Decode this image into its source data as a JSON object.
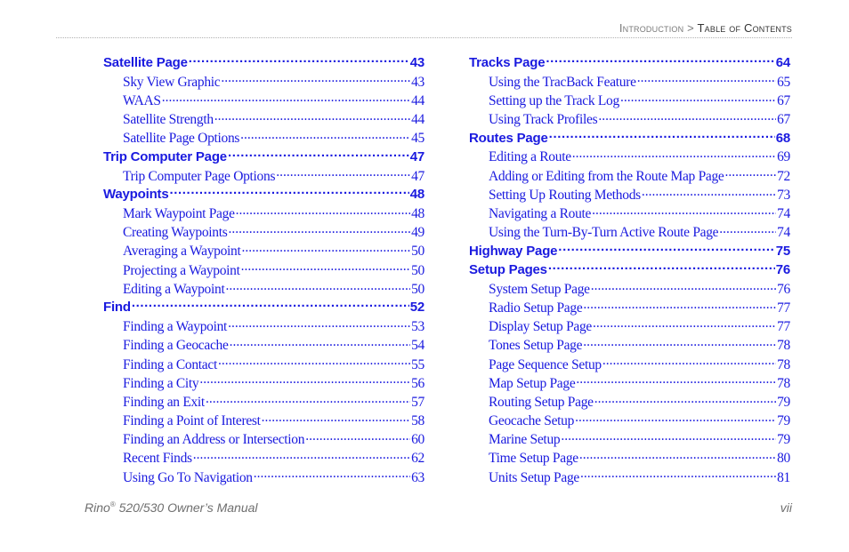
{
  "header": {
    "breadcrumb_parent": "Introduction",
    "breadcrumb_separator": " > ",
    "breadcrumb_current": "Table of Contents"
  },
  "colors": {
    "link": "#1a1adf",
    "header_text": "#7a7a7a",
    "footer_text": "#6f6f6f"
  },
  "toc": {
    "left": [
      {
        "level": 1,
        "title": "Satellite Page",
        "page": "43"
      },
      {
        "level": 2,
        "title": "Sky View Graphic",
        "page": "43"
      },
      {
        "level": 2,
        "title": "WAAS",
        "page": "44"
      },
      {
        "level": 2,
        "title": "Satellite Strength",
        "page": "44"
      },
      {
        "level": 2,
        "title": "Satellite Page Options",
        "page": "45"
      },
      {
        "level": 1,
        "title": "Trip Computer Page",
        "page": "47"
      },
      {
        "level": 2,
        "title": "Trip Computer Page Options",
        "page": "47"
      },
      {
        "level": 1,
        "title": "Waypoints",
        "page": "48"
      },
      {
        "level": 2,
        "title": "Mark Waypoint Page",
        "page": "48"
      },
      {
        "level": 2,
        "title": "Creating Waypoints",
        "page": "49"
      },
      {
        "level": 2,
        "title": "Averaging a Waypoint",
        "page": "50"
      },
      {
        "level": 2,
        "title": "Projecting a Waypoint",
        "page": "50"
      },
      {
        "level": 2,
        "title": "Editing a Waypoint",
        "page": "50"
      },
      {
        "level": 1,
        "title": "Find",
        "page": "52"
      },
      {
        "level": 2,
        "title": "Finding a Waypoint",
        "page": "53"
      },
      {
        "level": 2,
        "title": "Finding a Geocache",
        "page": "54"
      },
      {
        "level": 2,
        "title": "Finding a Contact",
        "page": "55"
      },
      {
        "level": 2,
        "title": "Finding a City",
        "page": "56"
      },
      {
        "level": 2,
        "title": "Finding an Exit",
        "page": "57"
      },
      {
        "level": 2,
        "title": "Finding a Point of Interest",
        "page": "58"
      },
      {
        "level": 2,
        "title": "Finding an Address or Intersection",
        "page": "60"
      },
      {
        "level": 2,
        "title": "Recent Finds",
        "page": "62"
      },
      {
        "level": 2,
        "title": "Using Go To Navigation",
        "page": "63"
      }
    ],
    "right": [
      {
        "level": 1,
        "title": "Tracks Page",
        "page": "64"
      },
      {
        "level": 2,
        "title": "Using the TracBack Feature",
        "page": "65"
      },
      {
        "level": 2,
        "title": "Setting up the Track Log",
        "page": "67"
      },
      {
        "level": 2,
        "title": "Using Track Profiles",
        "page": "67"
      },
      {
        "level": 1,
        "title": "Routes Page",
        "page": "68"
      },
      {
        "level": 2,
        "title": "Editing a Route",
        "page": "69"
      },
      {
        "level": 2,
        "title": "Adding or Editing from the Route Map Page",
        "page": "72"
      },
      {
        "level": 2,
        "title": "Setting Up Routing Methods",
        "page": "73"
      },
      {
        "level": 2,
        "title": "Navigating a Route",
        "page": "74"
      },
      {
        "level": 2,
        "title": "Using the Turn-By-Turn Active Route Page",
        "page": "74"
      },
      {
        "level": 1,
        "title": "Highway Page",
        "page": "75"
      },
      {
        "level": 1,
        "title": "Setup Pages",
        "page": "76"
      },
      {
        "level": 2,
        "title": "System Setup Page",
        "page": "76"
      },
      {
        "level": 2,
        "title": "Radio Setup Page",
        "page": "77"
      },
      {
        "level": 2,
        "title": "Display Setup Page",
        "page": "77"
      },
      {
        "level": 2,
        "title": "Tones Setup Page",
        "page": "78"
      },
      {
        "level": 2,
        "title": "Page Sequence Setup",
        "page": "78"
      },
      {
        "level": 2,
        "title": "Map Setup Page",
        "page": "78"
      },
      {
        "level": 2,
        "title": "Routing Setup Page",
        "page": "79"
      },
      {
        "level": 2,
        "title": "Geocache Setup",
        "page": "79"
      },
      {
        "level": 2,
        "title": "Marine Setup",
        "page": "79"
      },
      {
        "level": 2,
        "title": "Time Setup Page",
        "page": "80"
      },
      {
        "level": 2,
        "title": "Units Setup Page",
        "page": "81"
      }
    ]
  },
  "footer": {
    "product": "Rino",
    "registered_mark": "®",
    "manual_title": " 520/530 Owner’s Manual",
    "page_number": "vii"
  }
}
